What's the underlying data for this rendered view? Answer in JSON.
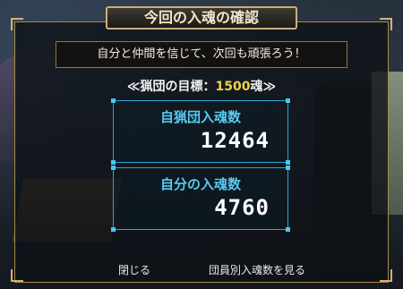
{
  "dialog": {
    "title": "今回の入魂の確認",
    "message": "自分と仲間を信じて、次回も頑張ろう！",
    "goal_prefix": "≪猟団の目標：",
    "goal_value": "1500",
    "goal_suffix": "魂≫"
  },
  "counts": {
    "guild_label": "自猟団入魂数",
    "guild_value": "12464",
    "self_label": "自分の入魂数",
    "self_value": "4760"
  },
  "footer": {
    "close_label": "閉じる",
    "per_member_label": "団員別入魂数を見る"
  },
  "colors": {
    "accent_gold": "#cbb07a",
    "accent_blue": "#2aa6d8",
    "goal_yellow": "#f0d24a"
  }
}
